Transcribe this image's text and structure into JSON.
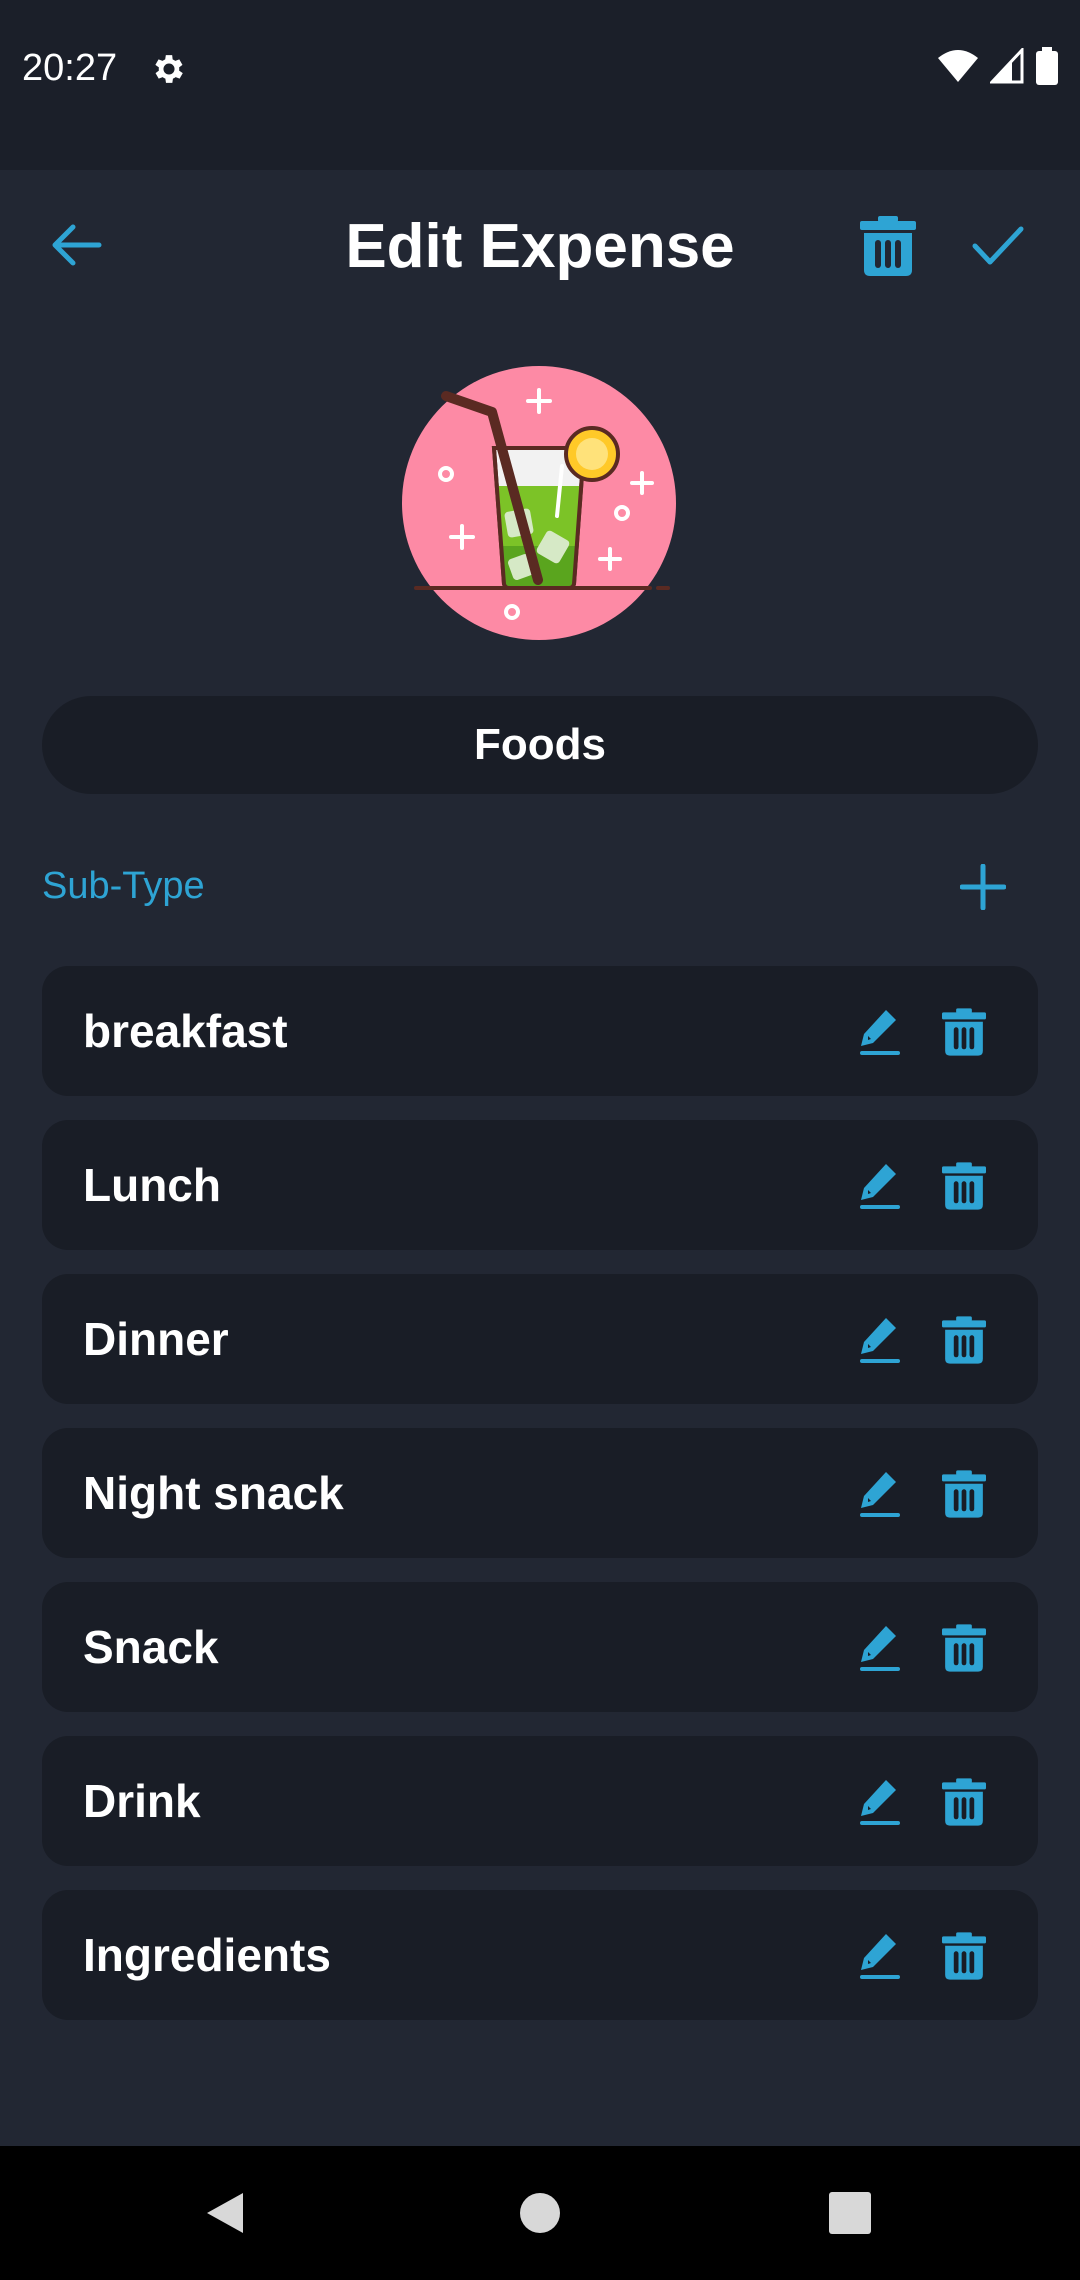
{
  "status_bar": {
    "time": "20:27",
    "icons": [
      "gear-icon",
      "wifi-icon",
      "signal-icon",
      "battery-icon"
    ]
  },
  "header": {
    "title": "Edit Expense",
    "back_icon": "arrow-left-icon",
    "delete_icon": "trash-icon",
    "confirm_icon": "check-icon"
  },
  "category": {
    "image_icon": "drink-glass-icon",
    "name": "Foods"
  },
  "subtypes": {
    "label": "Sub-Type",
    "add_icon": "plus-icon",
    "items": [
      {
        "label": "breakfast"
      },
      {
        "label": "Lunch"
      },
      {
        "label": "Dinner"
      },
      {
        "label": "Night snack"
      },
      {
        "label": "Snack"
      },
      {
        "label": "Drink"
      },
      {
        "label": "Ingredients"
      }
    ]
  },
  "nav_bar": {
    "icons": [
      "back-triangle-icon",
      "home-circle-icon",
      "recents-square-icon"
    ]
  },
  "colors": {
    "background": "#222733",
    "card": "#191d26",
    "accent": "#2ea4d4",
    "status_bar": "#1b1f29"
  }
}
